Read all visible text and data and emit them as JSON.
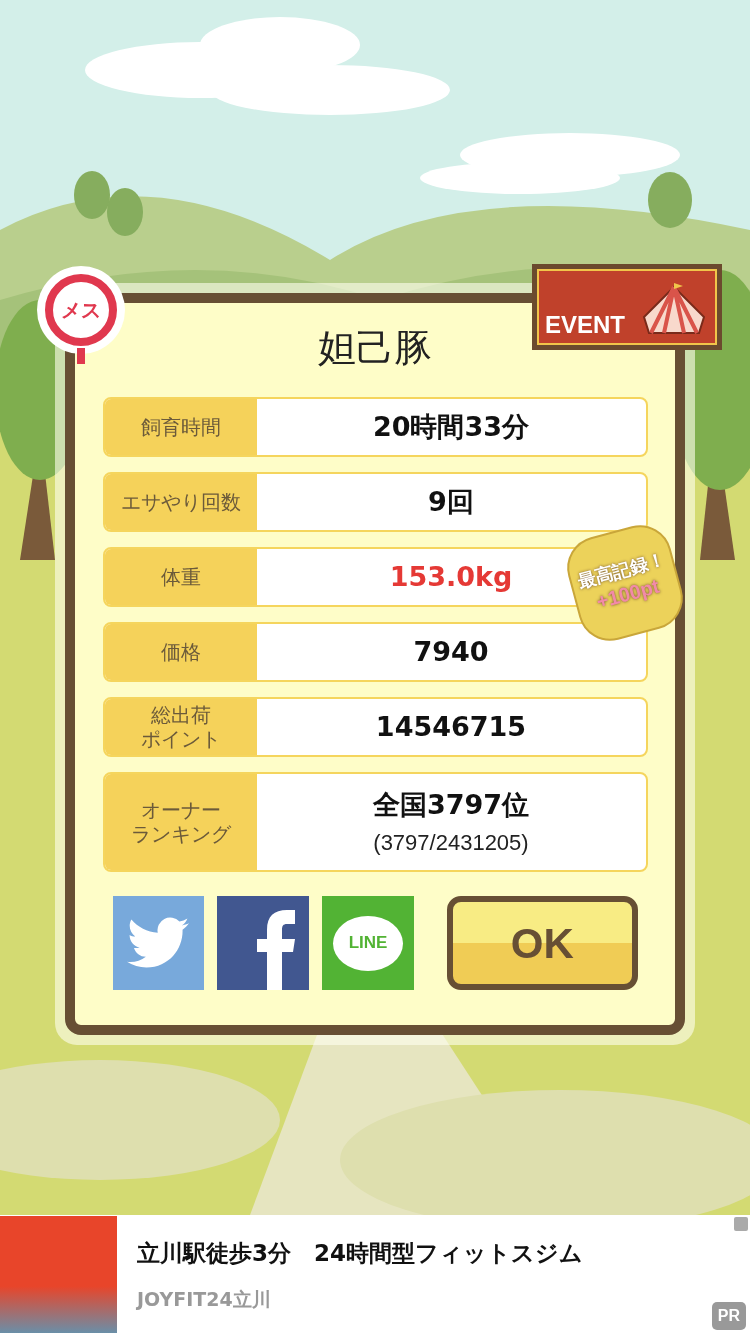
{
  "gender_badge": {
    "text": "メス"
  },
  "event_badge": {
    "text": "EVENT"
  },
  "title": "妲己豚",
  "stats": [
    {
      "label": [
        "飼育時間"
      ],
      "value": "20時間33分",
      "highlight": false
    },
    {
      "label": [
        "エサやり回数"
      ],
      "value": "9回",
      "highlight": false
    },
    {
      "label": [
        "体重"
      ],
      "value": "153.0kg",
      "highlight": true
    },
    {
      "label": [
        "価格"
      ],
      "value": "7940",
      "highlight": false
    },
    {
      "label": [
        "総出荷",
        "ポイント"
      ],
      "value": "14546715",
      "highlight": false
    },
    {
      "label": [
        "オーナー",
        "ランキング"
      ],
      "value": "全国3797位",
      "sub": "(3797/2431205)",
      "highlight": false
    }
  ],
  "record_badge": {
    "line1": "最高記録！",
    "line2": "+100pt"
  },
  "share": [
    {
      "kind": "twitter"
    },
    {
      "kind": "facebook"
    },
    {
      "kind": "line",
      "text": "LINE"
    }
  ],
  "ok_button": "OK",
  "ad": {
    "title": "立川駅徒歩3分　24時間型フィットスジム",
    "advertiser": "JOYFIT24立川",
    "pr": "PR"
  }
}
